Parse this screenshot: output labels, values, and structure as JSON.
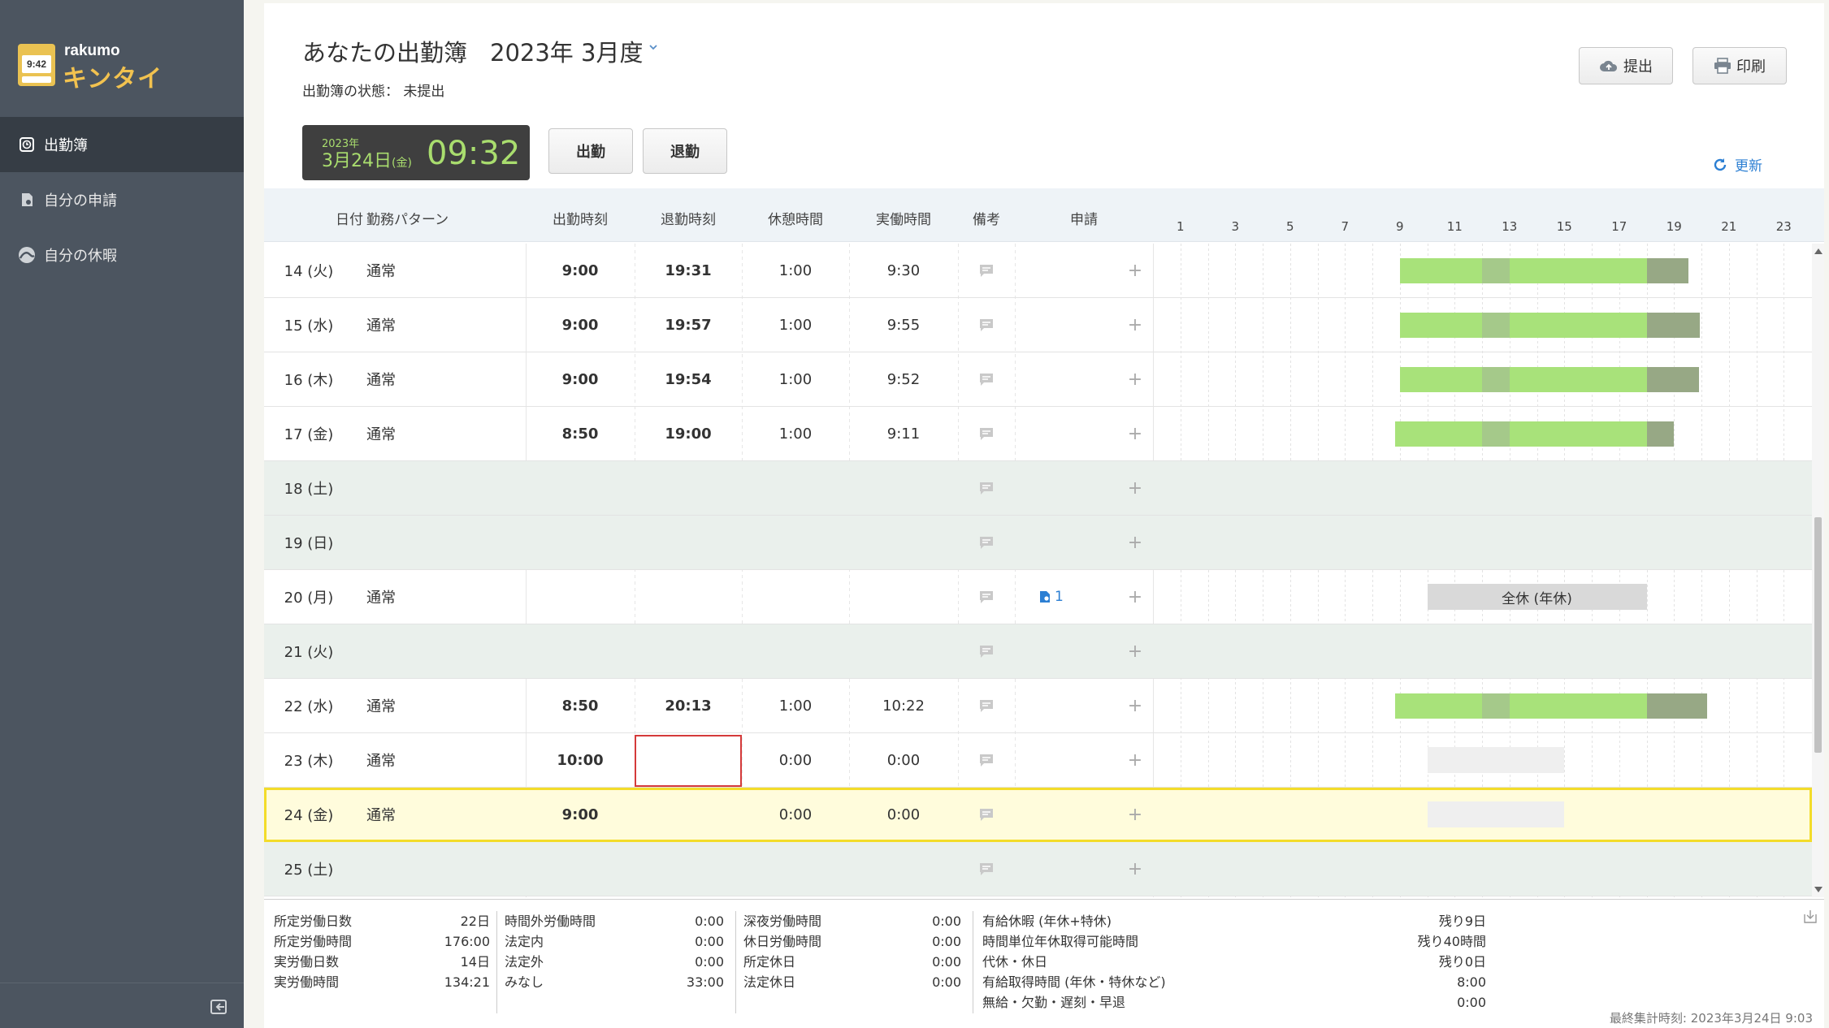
{
  "app": {
    "brand": "rakumo",
    "product": "キンタイ",
    "logo_clock": "9:42"
  },
  "sidebar": {
    "items": [
      {
        "label": "出勤簿",
        "icon": "attendance-clock-icon",
        "active": true
      },
      {
        "label": "自分の申請",
        "icon": "document-icon",
        "active": false
      },
      {
        "label": "自分の休暇",
        "icon": "vacation-icon",
        "active": false
      }
    ],
    "collapse_icon": "collapse-sidebar-icon"
  },
  "header": {
    "title": "あなたの出勤簿",
    "period": "2023年 3月度",
    "status_label": "出勤簿の状態：",
    "status_value": "未提出",
    "submit_label": "提出",
    "print_label": "印刷",
    "refresh_label": "更新"
  },
  "clock": {
    "year": "2023年",
    "date": "3月24日",
    "dow": "(金)",
    "time": "09:32"
  },
  "punch": {
    "in_label": "出勤",
    "out_label": "退勤"
  },
  "table": {
    "columns": {
      "date": "日付",
      "pattern": "勤務パターン",
      "in": "出勤時刻",
      "out": "退勤時刻",
      "rest": "休憩時間",
      "work": "実働時間",
      "memo": "備考",
      "request": "申請"
    },
    "hours": [
      "1",
      "3",
      "5",
      "7",
      "9",
      "11",
      "13",
      "15",
      "17",
      "19",
      "21",
      "23"
    ],
    "rows": [
      {
        "date": "14 (火)",
        "pattern": "通常",
        "in": "9:00",
        "out": "19:31",
        "rest": "1:00",
        "work": "9:30",
        "request": "",
        "kind": "work",
        "start": 9.0,
        "break_start": 12.0,
        "break_end": 13.0,
        "end": 19.52
      },
      {
        "date": "15 (水)",
        "pattern": "通常",
        "in": "9:00",
        "out": "19:57",
        "rest": "1:00",
        "work": "9:55",
        "request": "",
        "kind": "work",
        "start": 9.0,
        "break_start": 12.0,
        "break_end": 13.0,
        "end": 19.95
      },
      {
        "date": "16 (木)",
        "pattern": "通常",
        "in": "9:00",
        "out": "19:54",
        "rest": "1:00",
        "work": "9:52",
        "request": "",
        "kind": "work",
        "start": 9.0,
        "break_start": 12.0,
        "break_end": 13.0,
        "end": 19.9
      },
      {
        "date": "17 (金)",
        "pattern": "通常",
        "in": "8:50",
        "out": "19:00",
        "rest": "1:00",
        "work": "9:11",
        "request": "",
        "kind": "work",
        "start": 8.83,
        "break_start": 12.0,
        "break_end": 13.0,
        "end": 19.0
      },
      {
        "date": "18 (土)",
        "pattern": "",
        "in": "",
        "out": "",
        "rest": "",
        "work": "",
        "request": "",
        "kind": "weekend"
      },
      {
        "date": "19 (日)",
        "pattern": "",
        "in": "",
        "out": "",
        "rest": "",
        "work": "",
        "request": "",
        "kind": "weekend"
      },
      {
        "date": "20 (月)",
        "pattern": "通常",
        "in": "",
        "out": "",
        "rest": "",
        "work": "",
        "request": "1",
        "kind": "leave",
        "leave_label": "全休 (年休)",
        "start": 10.0,
        "end": 18.0
      },
      {
        "date": "21 (火)",
        "pattern": "",
        "in": "",
        "out": "",
        "rest": "",
        "work": "",
        "request": "",
        "kind": "weekend"
      },
      {
        "date": "22 (水)",
        "pattern": "通常",
        "in": "8:50",
        "out": "20:13",
        "rest": "1:00",
        "work": "10:22",
        "request": "",
        "kind": "work",
        "start": 8.83,
        "break_start": 12.0,
        "break_end": 13.0,
        "end": 20.22
      },
      {
        "date": "23 (木)",
        "pattern": "通常",
        "in": "10:00",
        "out": "",
        "rest": "0:00",
        "work": "0:00",
        "request": "",
        "kind": "sched",
        "start": 10.0,
        "end": 15.0
      },
      {
        "date": "24 (金)",
        "pattern": "通常",
        "in": "9:00",
        "out": "",
        "rest": "0:00",
        "work": "0:00",
        "request": "",
        "kind": "today",
        "start": 10.0,
        "end": 15.0
      },
      {
        "date": "25 (土)",
        "pattern": "",
        "in": "",
        "out": "",
        "rest": "",
        "work": "",
        "request": "",
        "kind": "weekend"
      }
    ]
  },
  "summary": {
    "col1": [
      {
        "k": "所定労働日数",
        "v": "22日"
      },
      {
        "k": "所定労働時間",
        "v": "176:00"
      },
      {
        "k": "実労働日数",
        "v": "14日"
      },
      {
        "k": "実労働時間",
        "v": "134:21"
      }
    ],
    "col2": [
      {
        "k": "時間外労働時間",
        "v": "0:00"
      },
      {
        "k": "法定内",
        "v": "0:00"
      },
      {
        "k": "法定外",
        "v": "0:00"
      },
      {
        "k": "みなし",
        "v": "33:00"
      }
    ],
    "col3": [
      {
        "k": "深夜労働時間",
        "v": "0:00"
      },
      {
        "k": "休日労働時間",
        "v": "0:00"
      },
      {
        "k": "所定休日",
        "v": "0:00"
      },
      {
        "k": "法定休日",
        "v": "0:00"
      }
    ],
    "col4": [
      {
        "k": "有給休暇 (年休+特休)",
        "v": "残り9日"
      },
      {
        "k": "時間単位年休取得可能時間",
        "v": "残り40時間"
      },
      {
        "k": "代休・休日",
        "v": "残り0日"
      },
      {
        "k": "有給取得時間 (年休・特休など)",
        "v": "8:00"
      },
      {
        "k": "無給・欠勤・遅刻・早退",
        "v": "0:00"
      }
    ],
    "last_calc": "最終集計時刻: 2023年3月24日 9:03"
  },
  "colors": {
    "work_green": "#a8e27a",
    "break_green": "#a5c98a",
    "overtime": "#97a885",
    "today_border": "#f3dc2a",
    "accent_blue": "#2c7fd3"
  }
}
